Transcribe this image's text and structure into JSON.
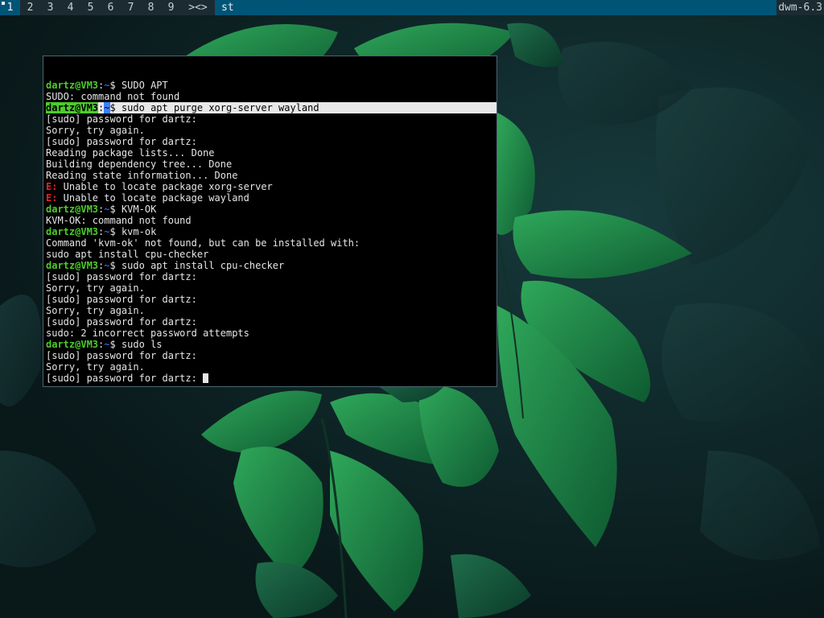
{
  "bar": {
    "tags": [
      "1",
      "2",
      "3",
      "4",
      "5",
      "6",
      "7",
      "8",
      "9"
    ],
    "selected_tag": "1",
    "layout": "><>",
    "window_title": "st",
    "status": "dwm-6.3"
  },
  "colors": {
    "bar_bg": "#1c2b32",
    "bar_selected": "#005577",
    "prompt_user": "#4ccd2a",
    "prompt_path": "#3c7fff",
    "error": "#e0242a"
  },
  "terminal": {
    "lines": [
      {
        "type": "prompt",
        "user": "dartz@VM3",
        "path": "~",
        "cmd": "SUDO APT"
      },
      {
        "type": "text",
        "text": "SUDO: command not found"
      },
      {
        "type": "prompt",
        "user": "dartz@VM3",
        "path": "~",
        "cmd": "sudo apt purge xorg-server wayland",
        "selected": true
      },
      {
        "type": "text",
        "text": "[sudo] password for dartz:"
      },
      {
        "type": "text",
        "text": "Sorry, try again."
      },
      {
        "type": "text",
        "text": "[sudo] password for dartz:"
      },
      {
        "type": "text",
        "text": "Reading package lists... Done"
      },
      {
        "type": "text",
        "text": "Building dependency tree... Done"
      },
      {
        "type": "text",
        "text": "Reading state information... Done"
      },
      {
        "type": "error",
        "prefix": "E:",
        "text": " Unable to locate package xorg-server"
      },
      {
        "type": "error",
        "prefix": "E:",
        "text": " Unable to locate package wayland"
      },
      {
        "type": "prompt",
        "user": "dartz@VM3",
        "path": "~",
        "cmd": "KVM-OK"
      },
      {
        "type": "text",
        "text": "KVM-OK: command not found"
      },
      {
        "type": "prompt",
        "user": "dartz@VM3",
        "path": "~",
        "cmd": "kvm-ok"
      },
      {
        "type": "text",
        "text": "Command 'kvm-ok' not found, but can be installed with:"
      },
      {
        "type": "text",
        "text": "sudo apt install cpu-checker"
      },
      {
        "type": "prompt",
        "user": "dartz@VM3",
        "path": "~",
        "cmd": "sudo apt install cpu-checker"
      },
      {
        "type": "text",
        "text": "[sudo] password for dartz:"
      },
      {
        "type": "text",
        "text": "Sorry, try again."
      },
      {
        "type": "text",
        "text": "[sudo] password for dartz:"
      },
      {
        "type": "text",
        "text": "Sorry, try again."
      },
      {
        "type": "text",
        "text": "[sudo] password for dartz:"
      },
      {
        "type": "text",
        "text": "sudo: 2 incorrect password attempts"
      },
      {
        "type": "prompt",
        "user": "dartz@VM3",
        "path": "~",
        "cmd": "sudo ls"
      },
      {
        "type": "text",
        "text": "[sudo] password for dartz:"
      },
      {
        "type": "text",
        "text": "Sorry, try again."
      },
      {
        "type": "text",
        "text": "[sudo] password for dartz: ",
        "cursor": true
      }
    ]
  }
}
